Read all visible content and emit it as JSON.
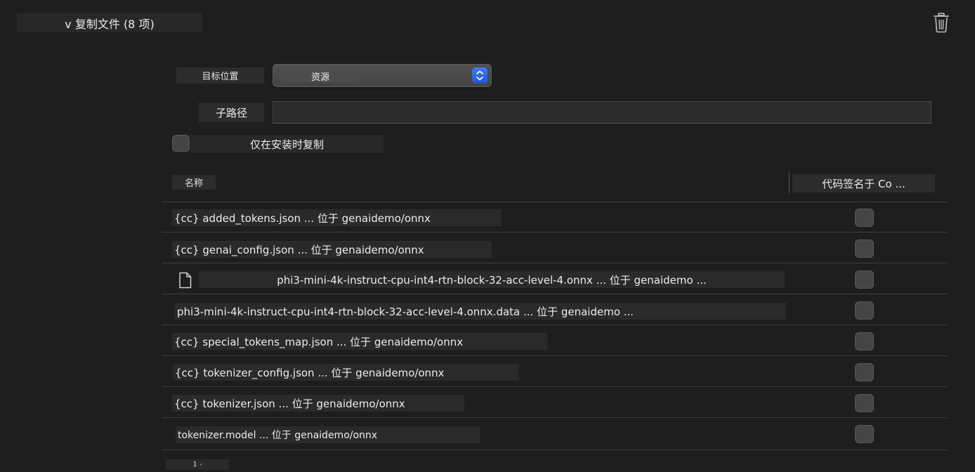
{
  "section": {
    "title": "v 复制文件 (8 项)"
  },
  "icons": {
    "delete": "trash-icon",
    "file": "document-icon",
    "stepper": "up-down-chevron-icon"
  },
  "colors": {
    "background": "#1e1e1e",
    "accent": "#2f6be6"
  },
  "form": {
    "target_label": "目标位置",
    "target_value": "资源",
    "subpath_label": "子路径",
    "subpath_value": "",
    "copy_only_when_installing_label": "仅在安装时复制",
    "copy_only_when_installing_checked": false
  },
  "table": {
    "col_name": "名称",
    "col_codesign": "代码签名于 Co ...",
    "rows": [
      {
        "label": "{cc} added_tokens.json ... 位于 genaidemo/onnx",
        "codesign": false
      },
      {
        "label": "{cc} genai_config.json ... 位于 genaidemo/onnx",
        "codesign": false
      },
      {
        "label": "phi3-mini-4k-instruct-cpu-int4-rtn-block-32-acc-level-4.onnx ... 位于 genaidemo ...",
        "codesign": false
      },
      {
        "label": "phi3-mini-4k-instruct-cpu-int4-rtn-block-32-acc-level-4.onnx.data ... 位于 genaidemo ...",
        "codesign": false
      },
      {
        "label": "{cc} special_tokens_map.json ... 位于 genaidemo/onnx",
        "codesign": false
      },
      {
        "label": "{cc} tokenizer_config.json ... 位于 genaidemo/onnx",
        "codesign": false
      },
      {
        "label": "{cc} tokenizer.json ... 位于 genaidemo/onnx",
        "codesign": false
      },
      {
        "label": "tokenizer.model ... 位于 genaidemo/onnx",
        "codesign": false
      }
    ]
  },
  "footer": {
    "text": "1 -"
  }
}
